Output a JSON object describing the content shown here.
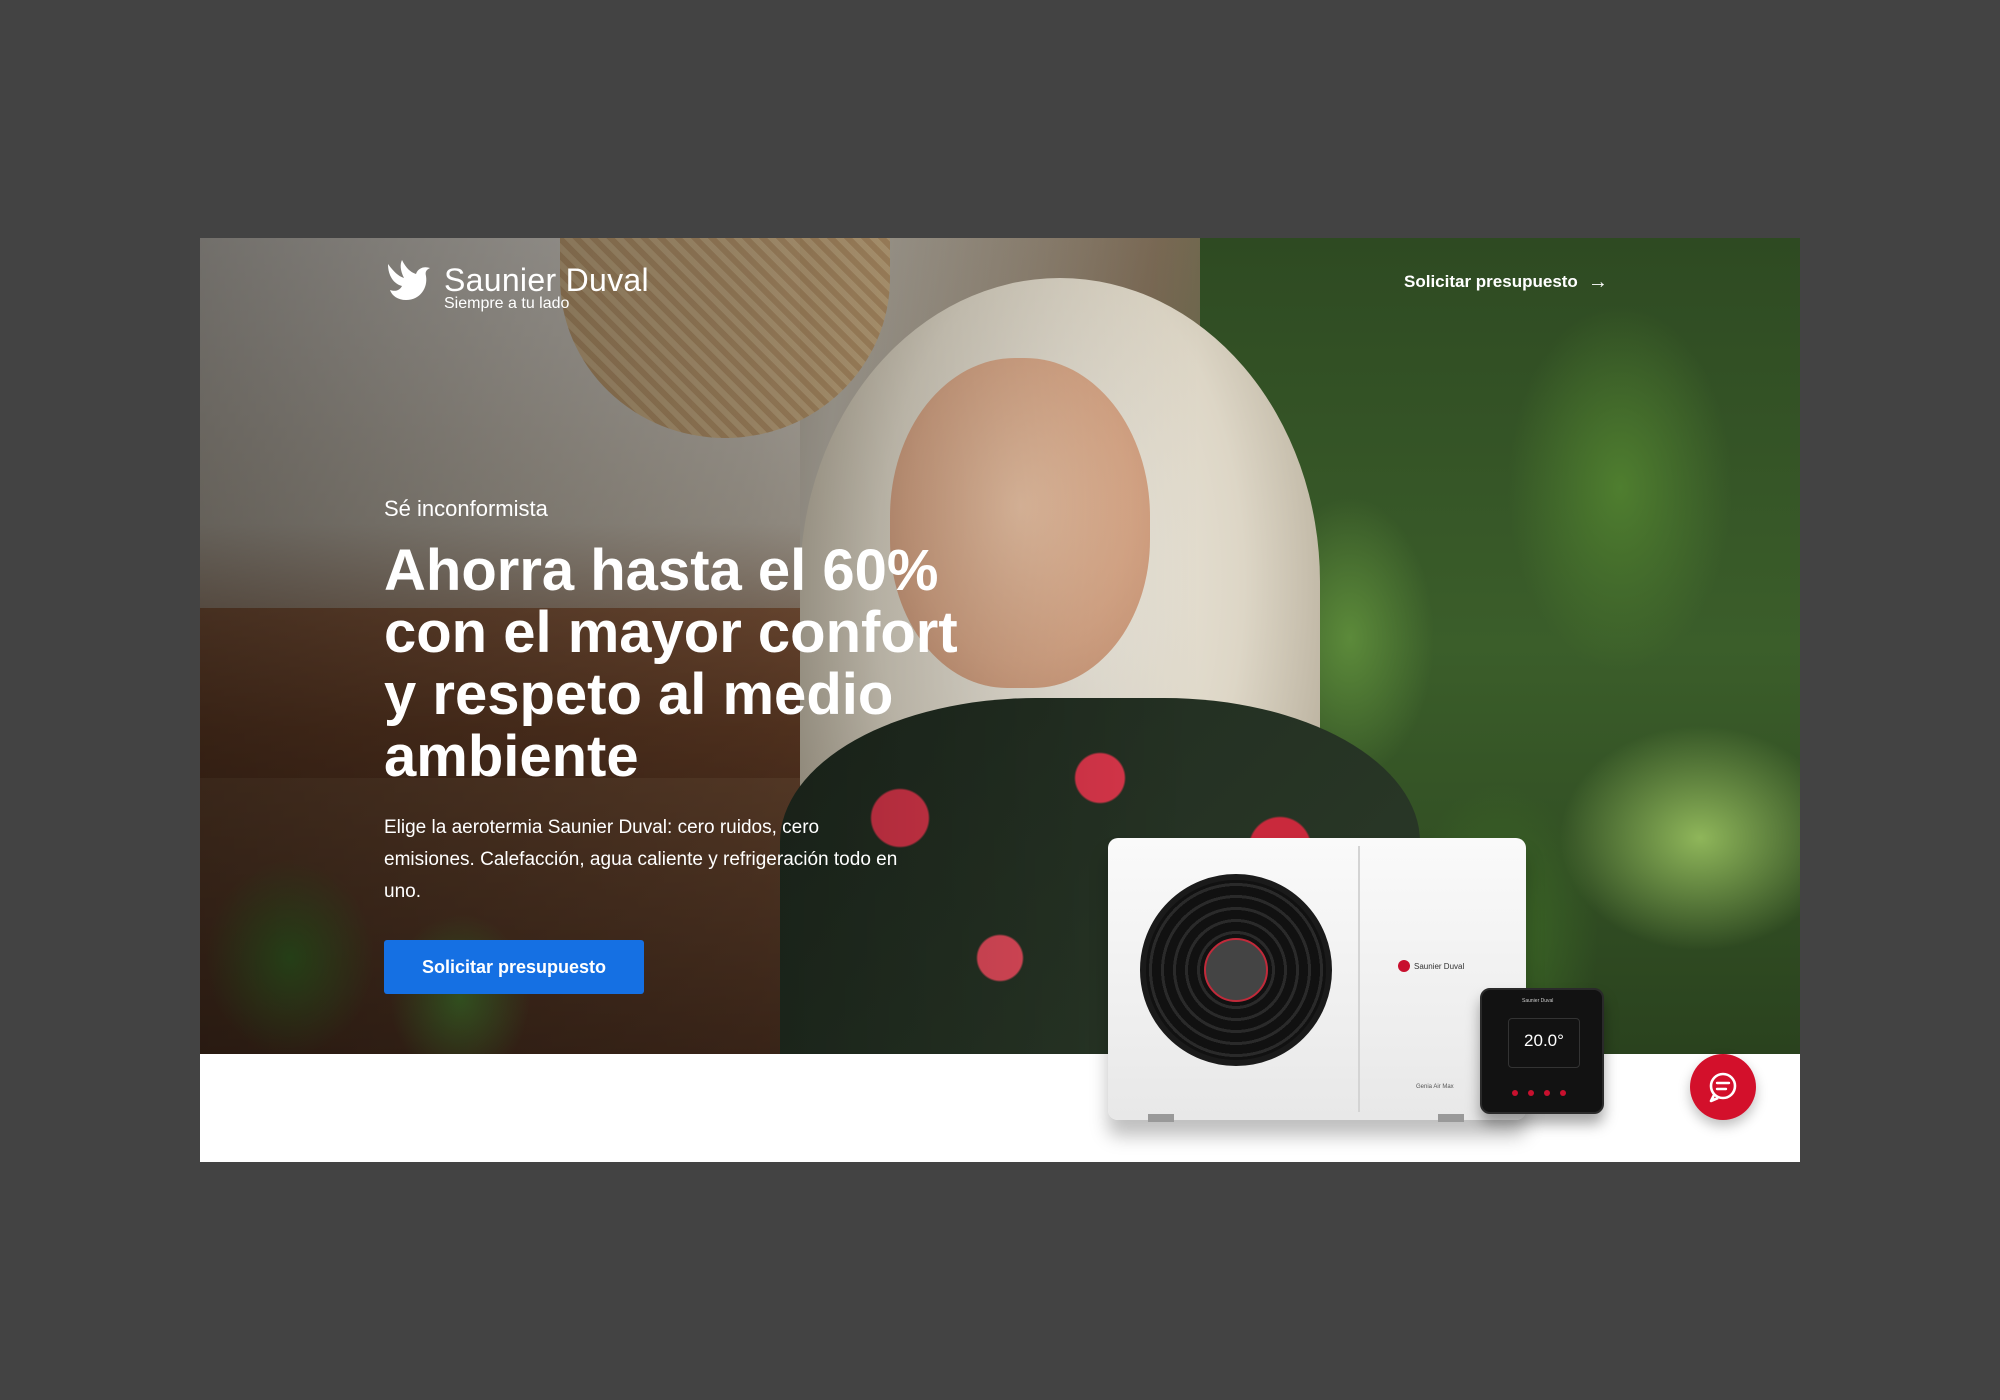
{
  "brand": {
    "name": "Saunier Duval",
    "tagline": "Siempre a tu lado"
  },
  "header": {
    "cta_label": "Solicitar presupuesto"
  },
  "hero": {
    "eyebrow": "Sé inconformista",
    "headline": "Ahorra hasta el 60% con el mayor confort y respeto al medio ambiente",
    "description": "Elige la aerotermia Saunier Duval: cero ruidos, cero emisiones. Calefacción, agua caliente y refrigeración todo en uno.",
    "cta_label": "Solicitar presupuesto"
  },
  "product": {
    "heatpump_brand": "Saunier Duval",
    "heatpump_model": "Genia Air Max",
    "thermostat_temp": "20.0°",
    "thermostat_brand": "Saunier Duval"
  },
  "colors": {
    "primary_button": "#1570e3",
    "chat_button": "#d3102b",
    "page_background": "#434343"
  },
  "icons": {
    "logo": "bird-logo-icon",
    "header_arrow": "arrow-right-icon",
    "chat": "chat-bubble-icon"
  }
}
